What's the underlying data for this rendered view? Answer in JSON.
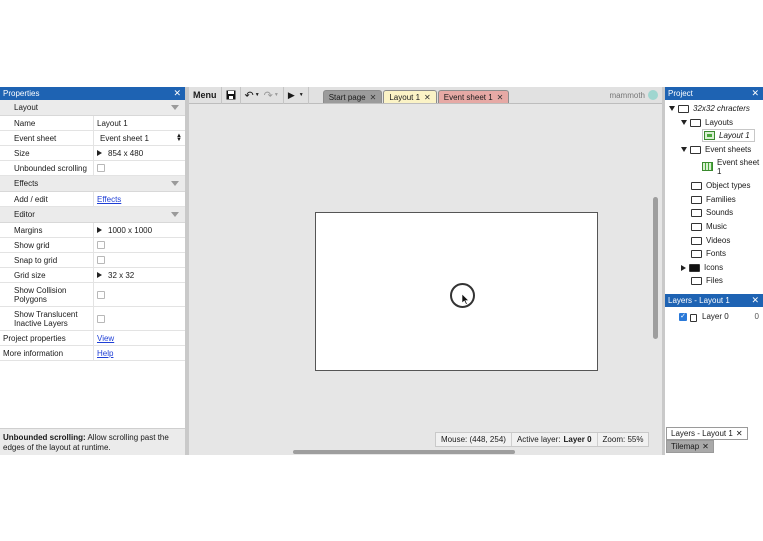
{
  "properties": {
    "title": "Properties",
    "close": "✕",
    "sections": {
      "layout": "Layout",
      "effects": "Effects",
      "editor": "Editor"
    },
    "rows": {
      "name": {
        "label": "Name",
        "value": "Layout 1"
      },
      "event_sheet": {
        "label": "Event sheet",
        "value": "Event sheet 1"
      },
      "size": {
        "label": "Size",
        "value": "854 x 480"
      },
      "unbounded": {
        "label": "Unbounded scrolling"
      },
      "add_edit": {
        "label": "Add / edit",
        "value": "Effects"
      },
      "margins": {
        "label": "Margins",
        "value": "1000 x 1000"
      },
      "show_grid": {
        "label": "Show grid"
      },
      "snap_grid": {
        "label": "Snap to grid"
      },
      "grid_size": {
        "label": "Grid size",
        "value": "32 x 32"
      },
      "show_collision_1": "Show Collision",
      "show_collision_2": "Polygons",
      "show_translucent_1": "Show Translucent",
      "show_translucent_2": "Inactive Layers",
      "project_properties": {
        "label": "Project properties",
        "value": "View"
      },
      "more_info": {
        "label": "More information",
        "value": "Help"
      }
    },
    "help": {
      "bold": "Unbounded scrolling:",
      "text": " Allow scrolling past the edges of the layout at runtime."
    }
  },
  "toolbar": {
    "menu": "Menu",
    "save_icon": "save-icon",
    "undo_icon": "undo-icon",
    "redo_icon": "redo-icon",
    "play_icon": "play-icon",
    "brand": "mammoth"
  },
  "tabs": [
    {
      "label": "Start page",
      "color": "#9b9b9b"
    },
    {
      "label": "Layout 1",
      "color": "#fbf3c6"
    },
    {
      "label": "Event sheet 1",
      "color": "#e6a9a5"
    }
  ],
  "status": {
    "mouse": "Mouse: (448, 254)",
    "active_layer_label": "Active layer:",
    "active_layer_value": "Layer 0",
    "zoom": "Zoom: 55%"
  },
  "project": {
    "title": "Project",
    "close": "✕",
    "root": "32x32 chracters",
    "layouts": "Layouts",
    "layout_1": "Layout 1",
    "event_sheets": "Event sheets",
    "event_sheet_1a": "Event sheet",
    "event_sheet_1b": "1",
    "object_types": "Object types",
    "families": "Families",
    "sounds": "Sounds",
    "music": "Music",
    "videos": "Videos",
    "fonts": "Fonts",
    "icons": "Icons",
    "files": "Files"
  },
  "layers": {
    "title": "Layers - Layout 1",
    "close": "✕",
    "layer_name": "Layer 0",
    "layer_index": "0",
    "bottom_tab": "Layers - Layout 1",
    "bottom_tab_close": "✕",
    "tilemap_tab": "Tilemap",
    "tilemap_close": "✕"
  }
}
